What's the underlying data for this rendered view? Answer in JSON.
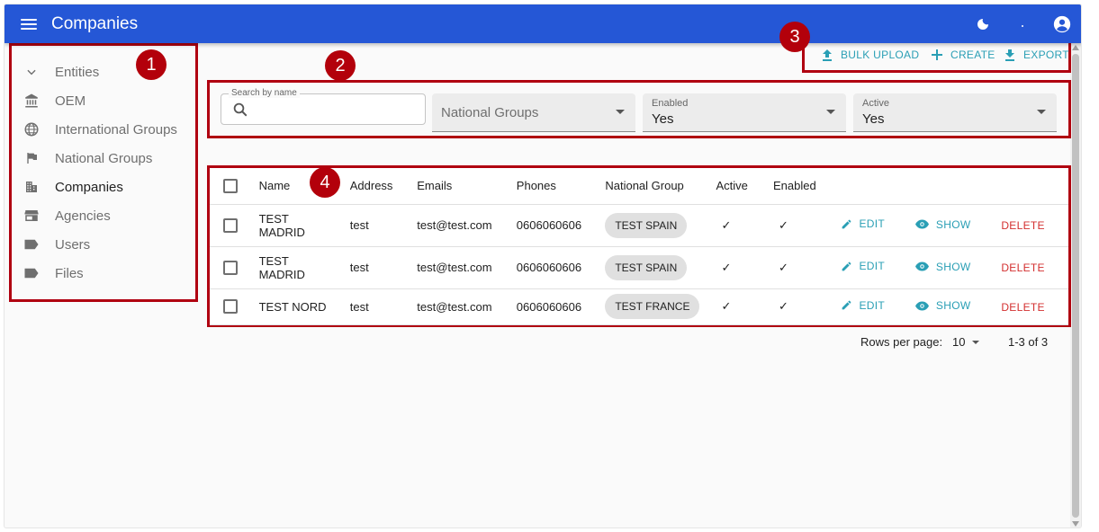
{
  "appbar": {
    "title": "Companies"
  },
  "sidebar": {
    "items": [
      {
        "label": "Entities"
      },
      {
        "label": "OEM"
      },
      {
        "label": "International Groups"
      },
      {
        "label": "National Groups"
      },
      {
        "label": "Companies"
      },
      {
        "label": "Agencies"
      },
      {
        "label": "Users"
      },
      {
        "label": "Files"
      }
    ]
  },
  "badges": [
    "1",
    "2",
    "3",
    "4"
  ],
  "toolbar": {
    "bulk_upload": "BULK UPLOAD",
    "create": "CREATE",
    "export": "EXPORT"
  },
  "filters": {
    "search_label": "Search by name",
    "search_value": "",
    "national_groups_placeholder": "National Groups",
    "enabled_label": "Enabled",
    "enabled_value": "Yes",
    "active_label": "Active",
    "active_value": "Yes"
  },
  "table": {
    "headers": {
      "name": "Name",
      "address": "Address",
      "emails": "Emails",
      "phones": "Phones",
      "national_group": "National Group",
      "active": "Active",
      "enabled": "Enabled"
    },
    "actions": {
      "edit": "EDIT",
      "show": "SHOW",
      "delete": "DELETE"
    },
    "rows": [
      {
        "name_line1": "TEST",
        "name_line2": "MADRID",
        "address": "test",
        "email": "test@test.com",
        "phone": "0606060606",
        "national_group": "TEST SPAIN",
        "active": "✓",
        "enabled": "✓"
      },
      {
        "name_line1": "TEST",
        "name_line2": "MADRID",
        "address": "test",
        "email": "test@test.com",
        "phone": "0606060606",
        "national_group": "TEST SPAIN",
        "active": "✓",
        "enabled": "✓"
      },
      {
        "name_line1": "TEST NORD",
        "name_line2": "",
        "address": "test",
        "email": "test@test.com",
        "phone": "0606060606",
        "national_group": "TEST FRANCE",
        "active": "✓",
        "enabled": "✓"
      }
    ]
  },
  "pagination": {
    "rows_per_page_label": "Rows per page:",
    "rows_per_page_value": "10",
    "range": "1-3 of 3"
  },
  "colors": {
    "appbar": "#2557d6",
    "accent": "#2a9fb5",
    "danger": "#d32f2f",
    "annotation": "#b00010"
  }
}
